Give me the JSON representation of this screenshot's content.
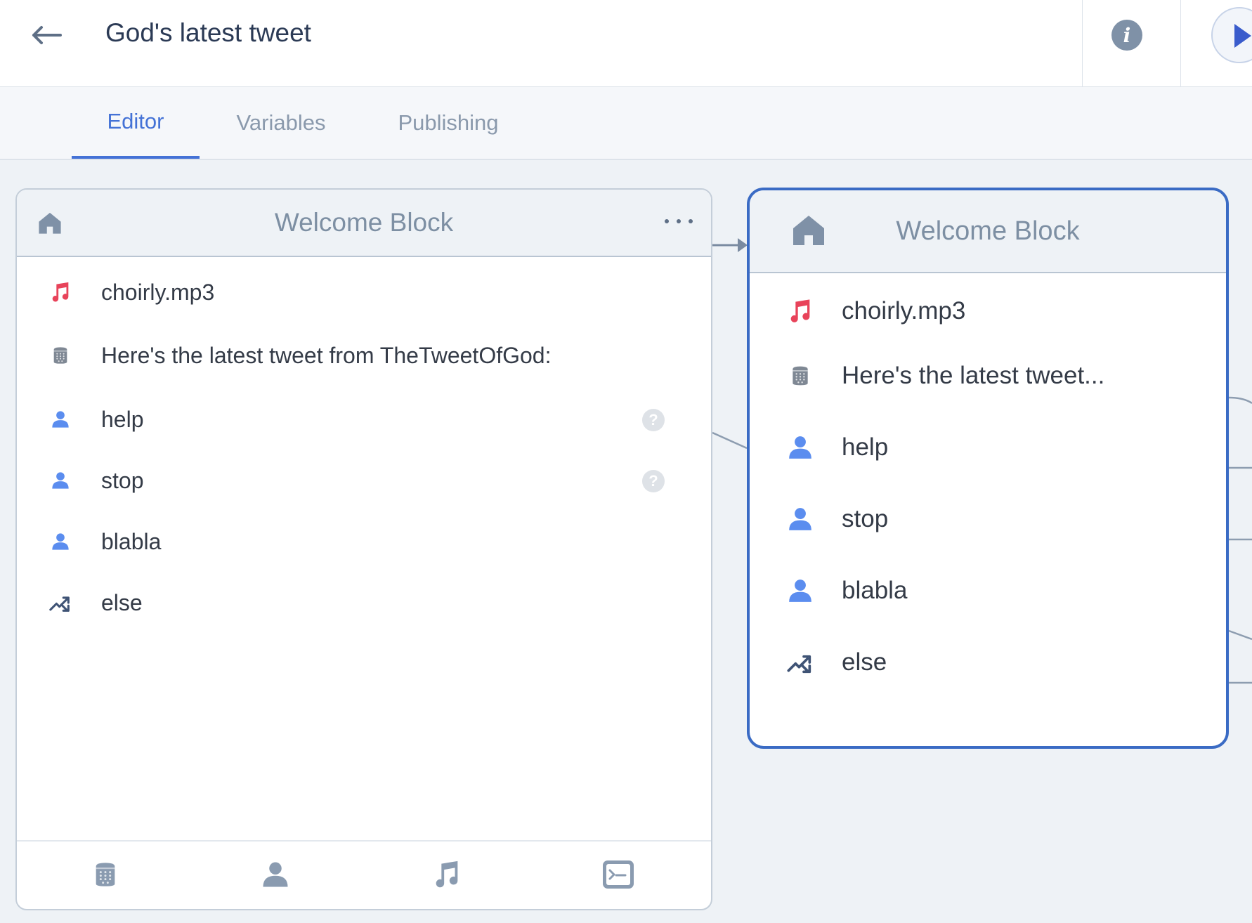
{
  "header": {
    "title": "God's latest tweet"
  },
  "tabs": [
    {
      "label": "Editor",
      "active": true
    },
    {
      "label": "Variables",
      "active": false
    },
    {
      "label": "Publishing",
      "active": false
    }
  ],
  "blocks": [
    {
      "title": "Welcome Block",
      "items": [
        {
          "icon": "music-note-icon",
          "label": "choirly.mp3"
        },
        {
          "icon": "speaker-icon",
          "label": "Here's the latest tweet from TheTweetOfGod:"
        },
        {
          "icon": "user-icon",
          "label": "help",
          "help": "?"
        },
        {
          "icon": "user-icon",
          "label": "stop",
          "help": "?"
        },
        {
          "icon": "user-icon",
          "label": "blabla"
        },
        {
          "icon": "shuffle-icon",
          "label": "else"
        }
      ],
      "footer_tools": [
        "speaker-icon",
        "user-icon",
        "music-note-icon",
        "terminal-icon"
      ]
    },
    {
      "title": "Welcome Block",
      "selected": true,
      "items": [
        {
          "icon": "music-note-icon",
          "label": "choirly.mp3"
        },
        {
          "icon": "speaker-icon",
          "label": "Here's the latest tweet..."
        },
        {
          "icon": "user-icon",
          "label": "help"
        },
        {
          "icon": "user-icon",
          "label": "stop"
        },
        {
          "icon": "user-icon",
          "label": "blabla"
        },
        {
          "icon": "shuffle-icon",
          "label": "else"
        }
      ]
    }
  ],
  "colors": {
    "accent": "#4472d6",
    "selected_border": "#3a6bc4",
    "music_icon": "#e8435a",
    "user_icon": "#5b8def",
    "muted_icon": "#7f91a7"
  }
}
